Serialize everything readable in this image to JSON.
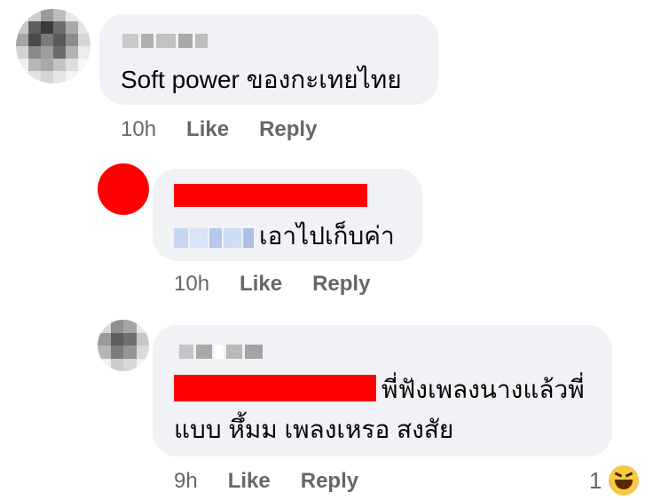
{
  "colors": {
    "bubble": "#f0f2f5",
    "meta_text": "#65676b",
    "redaction": "#ff0000",
    "reaction": "#f7c948"
  },
  "comments": [
    {
      "text": "Soft power ของกะเทยไทย",
      "time": "10h",
      "like": "Like",
      "reply": "Reply"
    },
    {
      "text": "เอาไปเก็บค่า",
      "time": "10h",
      "like": "Like",
      "reply": "Reply"
    },
    {
      "text_line1": "พี่ฟังเพลงนางแล้วพี่",
      "text_line2": "แบบ หึ้มม  เพลงเหรอ สงสัย",
      "time": "9h",
      "like": "Like",
      "reply": "Reply",
      "reaction_count": "1",
      "reaction_icon": "haha-emoji-icon"
    }
  ]
}
